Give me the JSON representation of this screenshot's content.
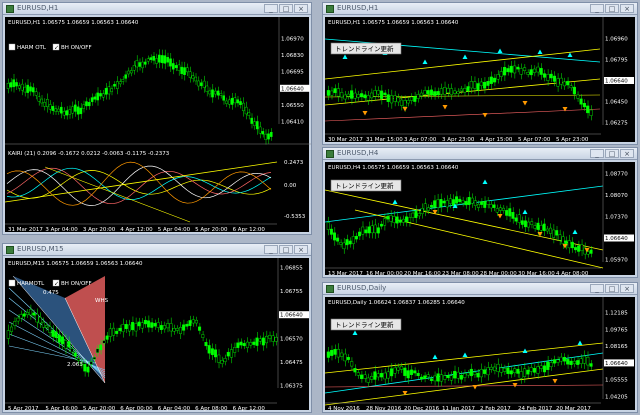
{
  "windows": [
    {
      "id": "w1",
      "title": "EURUSD,H1",
      "header": "EURUSD,H1  1.06575 1.06659 1.06563 1.06640",
      "checkboxes": [
        {
          "label": "HARM OTL",
          "checked": false
        },
        {
          "label": "BH ON/OFF",
          "checked": true
        }
      ],
      "price_labels": [
        "1.06970",
        "1.06830",
        "1.06695",
        "1.06640",
        "1.06550",
        "1.06410"
      ],
      "current_price": "1.06640",
      "subwindow_header": "KAIRI (21) 0.2096 -0.1672 0.0212 -0.0063 -0.1175 -0.2373",
      "sub_labels": [
        "0.2473",
        "0.00",
        "-0.5353"
      ],
      "time_labels": [
        "31 Mar 2017",
        "3 Apr 04:00",
        "3 Apr 20:00",
        "4 Apr 12:00",
        "5 Apr 04:00",
        "5 Apr 20:00",
        "6 Apr 12:00"
      ]
    },
    {
      "id": "w2",
      "title": "EURUSD,H1",
      "header": "EURUSD,H1  1.06575 1.06659 1.06563 1.06640",
      "button": "トレンドライン更新",
      "price_labels": [
        "1.06960",
        "1.06795",
        "1.06640",
        "1.06450",
        "1.06275"
      ],
      "current_price": "1.06640",
      "time_labels": [
        "30 Mar 2017",
        "31 Mar 15:00",
        "3 Apr 07:00",
        "3 Apr 23:00",
        "4 Apr 15:00",
        "5 Apr 07:00",
        "5 Apr 23:00"
      ]
    },
    {
      "id": "w3",
      "title": "EURUSD,M15",
      "header": "EURUSD,M15  1.06575 1.06659 1.06563 1.06640",
      "checkboxes": [
        {
          "label": "HARMOTL",
          "checked": false
        },
        {
          "label": "BH ON/OFF",
          "checked": true
        }
      ],
      "annotations": [
        "0.475",
        "WHS",
        "2.063"
      ],
      "price_labels": [
        "1.06855",
        "1.06755",
        "1.06640",
        "1.06570",
        "1.06475",
        "1.06375"
      ],
      "current_price": "1.06640",
      "time_labels": [
        "5 Apr 2017",
        "5 Apr 16:00",
        "5 Apr 20:00",
        "6 Apr 00:00",
        "6 Apr 04:00",
        "6 Apr 08:00",
        "6 Apr 12:00"
      ]
    },
    {
      "id": "w4",
      "title": "EURUSD,H4",
      "header": "EURUSD,H4  1.06575 1.06659 1.06563 1.06640",
      "button": "トレンドライン更新",
      "price_labels": [
        "1.08770",
        "1.08070",
        "1.07370",
        "1.06640",
        "1.05970"
      ],
      "current_price": "1.06640",
      "time_labels": [
        "13 Mar 2017",
        "16 Mar 00:00",
        "20 Mar 16:00",
        "23 Mar 08:00",
        "28 Mar 00:00",
        "30 Mar 16:00",
        "4 Apr 08:00"
      ]
    },
    {
      "id": "w5",
      "title": "EURUSD,Daily",
      "header": "EURUSD,Daily  1.06624 1.06837 1.06285 1.06640",
      "button": "トレンドライン更新",
      "price_labels": [
        "1.12185",
        "1.09765",
        "1.08165",
        "1.06640",
        "1.05555",
        "1.04205"
      ],
      "current_price": "1.06640",
      "time_labels": [
        "4 Nov 2016",
        "28 Nov 2016",
        "20 Dec 2016",
        "11 Jan 2017",
        "2 Feb 2017",
        "24 Feb 2017",
        "20 Mar 2017"
      ]
    }
  ],
  "controls": {
    "minimize": "_",
    "maximize": "□",
    "close": "×"
  },
  "colors": {
    "bull": "#00ff00",
    "bear": "#00ff00",
    "background": "#000000",
    "aqua": "#00ffff",
    "orange": "#ff9900",
    "yellow": "#ffff00"
  }
}
